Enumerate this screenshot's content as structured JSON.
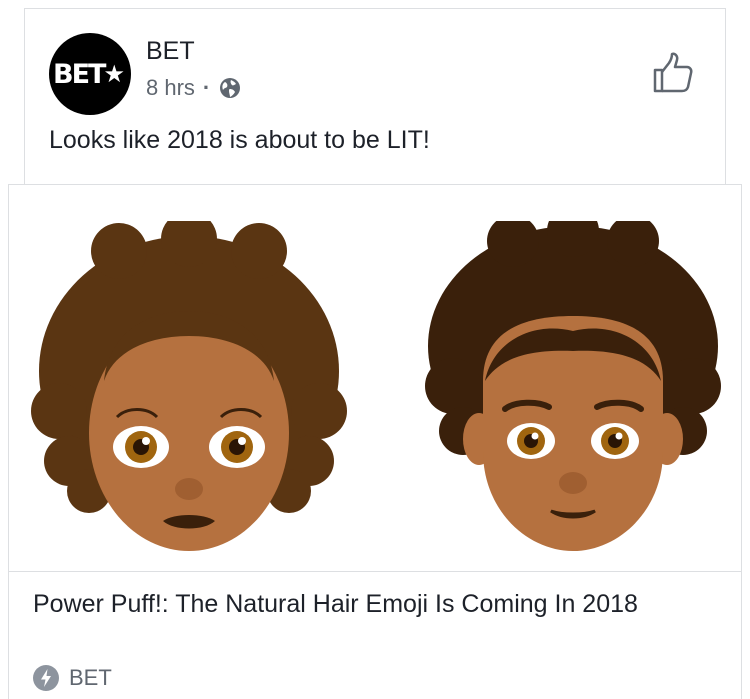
{
  "post": {
    "page_name": "BET",
    "avatar_text": "BET",
    "time": "8 hrs",
    "separator": "·",
    "privacy_icon": "globe-icon",
    "like_icon": "thumbs-up-icon",
    "message": "Looks like 2018 is about to be LIT!"
  },
  "link": {
    "image_description_icons": [
      "woman-curly-hair-emoji",
      "man-curly-hair-emoji"
    ],
    "title": "Power Puff!: The Natural Hair Emoji Is Coming In 2018",
    "source_icon": "lightning-bolt-icon",
    "source": "BET"
  },
  "colors": {
    "text_primary": "#1d2129",
    "text_secondary": "#606770",
    "border": "#dddfe2",
    "skin": "#b5713f",
    "hair_woman": "#5a3512",
    "hair_man": "#3a200b"
  }
}
